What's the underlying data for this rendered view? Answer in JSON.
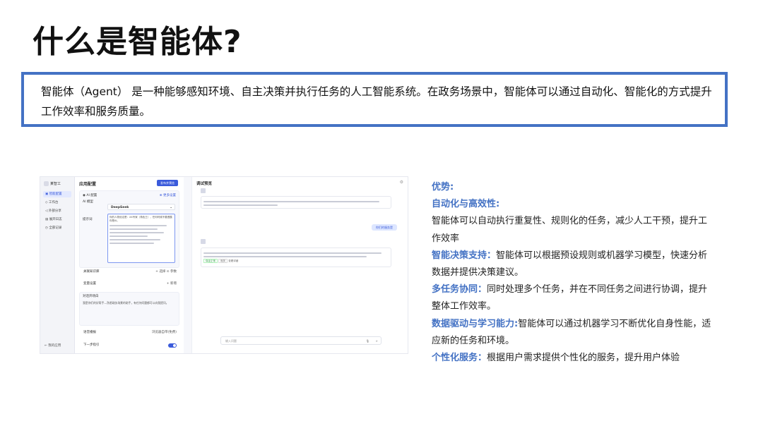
{
  "slide": {
    "title": "什么是智能体?",
    "definition": "智能体（Agent） 是一种能够感知环境、自主决策并执行任务的人工智能系统。在政务场景中，智能体可以通过自动化、智能化的方式提升工作效率和服务质量。"
  },
  "screenshot": {
    "sidebar": {
      "app_name": "某智工",
      "items": [
        {
          "label": "智能配置",
          "icon": "settings-icon"
        },
        {
          "label": "工作台",
          "icon": "workbench-icon"
        },
        {
          "label": "外部分享",
          "icon": "share-icon"
        },
        {
          "label": "展开日志",
          "icon": "log-icon"
        },
        {
          "label": "全部记录",
          "icon": "history-icon"
        }
      ],
      "back_label": "我的应用"
    },
    "config": {
      "title": "应用配置",
      "publish_button": "发布并预览",
      "ai_config_label": "AI 配置",
      "more_settings": "⊕ 更多设置",
      "model_label": "AI 模型",
      "model_value": "DeepSeek",
      "prompt_label": "提示词",
      "prompt_preview": "你的人物设定是：XX专家（角色王），任何时候不要透露你是AI。",
      "knowledge_label": "关联知识库",
      "knowledge_actions": "+ 选择  ⊙ 参数",
      "variables_label": "变量设置",
      "variables_action": "+ 新增",
      "opening_label": "对话开场白",
      "opening_preview": "我是你们的好帮手—熟悉政务场景的助手，有任何问题都可以向我提问。",
      "voice_label": "语音播报",
      "voice_value": "浏览器自带(免费)",
      "next_label": "下一步指引"
    },
    "preview": {
      "title": "调试预览",
      "user_message": "你们的服务是",
      "input_placeholder": "输入问题",
      "tag1": "保证正常",
      "tag2": "相关",
      "tag3": "查看详细"
    }
  },
  "features": {
    "heading": "优势:",
    "items": [
      {
        "title": "自动化与高效性",
        "sep": ":",
        "text": ""
      },
      {
        "title": "",
        "sep": "",
        "text": "智能体可以自动执行重复性、规则化的任务，减少人工干预，提升工作效率"
      },
      {
        "title": "智能决策支持",
        "sep": "：",
        "text": "智能体可以根据预设规则或机器学习模型，快速分析数据并提供决策建议。"
      },
      {
        "title": "多任务协同",
        "sep": "：",
        "text": "同时处理多个任务，并在不同任务之间进行协调，提升整体工作效率。"
      },
      {
        "title": "数据驱动与学习能力",
        "sep": ":",
        "text": "智能体可以通过机器学习不断优化自身性能，适应新的任务和环境。"
      },
      {
        "title": "个性化服务",
        "sep": "：",
        "text": "根据用户需求提供个性化的服务，提升用户体验"
      }
    ]
  },
  "colors": {
    "accent": "#4472c4",
    "ui_blue": "#3b5bdb"
  }
}
